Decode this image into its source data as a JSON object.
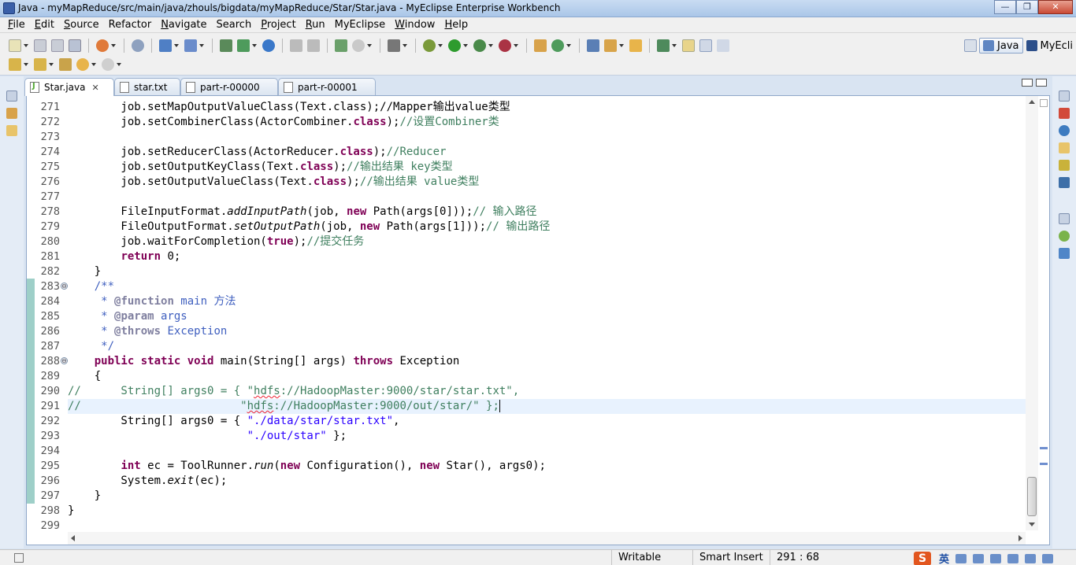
{
  "window": {
    "title": "Java - myMapReduce/src/main/java/zhouls/bigdata/myMapReduce/Star/Star.java - MyEclipse Enterprise Workbench",
    "minimize": "—",
    "maximize": "❐",
    "close": "✕"
  },
  "menu": [
    {
      "label": "File",
      "u": "F",
      "rest": "ile"
    },
    {
      "label": "Edit",
      "u": "E",
      "rest": "dit"
    },
    {
      "label": "Source",
      "u": "S",
      "rest": "ource"
    },
    {
      "label": "Refactor",
      "u": "",
      "rest": "Refactor"
    },
    {
      "label": "Navigate",
      "u": "N",
      "rest": "avigate"
    },
    {
      "label": "Search",
      "u": "",
      "rest": "Search"
    },
    {
      "label": "Project",
      "u": "P",
      "rest": "roject"
    },
    {
      "label": "Run",
      "u": "R",
      "rest": "un"
    },
    {
      "label": "MyEclipse",
      "u": "",
      "rest": "MyEclipse"
    },
    {
      "label": "Window",
      "u": "W",
      "rest": "indow"
    },
    {
      "label": "Help",
      "u": "H",
      "rest": "elp"
    }
  ],
  "perspectives": {
    "java": "Java",
    "myeclipse": "MyEcli"
  },
  "tabs": [
    {
      "label": "Star.java",
      "close": "✕",
      "active": true
    },
    {
      "label": "star.txt",
      "close": "",
      "active": false
    },
    {
      "label": "part-r-00000",
      "close": "",
      "active": false
    },
    {
      "label": "part-r-00001",
      "close": "",
      "active": false
    }
  ],
  "editor": {
    "lines": [
      {
        "n": "271",
        "fold": "",
        "html": "        job.setMapOutputValueClass(Text.class);//Mapper输出value类型"
      },
      {
        "n": "272",
        "fold": "",
        "html": "        job.setCombinerClass(ActorCombiner.<span class=\"kw\">class</span>);<span class=\"cm\">//设置Combiner类</span>"
      },
      {
        "n": "273",
        "fold": "",
        "html": ""
      },
      {
        "n": "274",
        "fold": "",
        "html": "        job.setReducerClass(ActorReducer.<span class=\"kw\">class</span>);<span class=\"cm\">//Reducer</span>"
      },
      {
        "n": "275",
        "fold": "",
        "html": "        job.setOutputKeyClass(Text.<span class=\"kw\">class</span>);<span class=\"cm\">//输出结果 key类型</span>"
      },
      {
        "n": "276",
        "fold": "",
        "html": "        job.setOutputValueClass(Text.<span class=\"kw\">class</span>);<span class=\"cm\">//输出结果 value类型</span>"
      },
      {
        "n": "277",
        "fold": "",
        "html": ""
      },
      {
        "n": "278",
        "fold": "",
        "html": "        FileInputFormat.<span class=\"it\">addInputPath</span>(job, <span class=\"kw\">new</span> Path(args[0]));<span class=\"cm\">// 输入路径</span>"
      },
      {
        "n": "279",
        "fold": "",
        "html": "        FileOutputFormat.<span class=\"it\">setOutputPath</span>(job, <span class=\"kw\">new</span> Path(args[1]));<span class=\"cm\">// 输出路径</span>"
      },
      {
        "n": "280",
        "fold": "",
        "html": "        job.waitForCompletion(<span class=\"kw\">true</span>);<span class=\"cm\">//提交任务</span>"
      },
      {
        "n": "281",
        "fold": "",
        "html": "        <span class=\"kw\">return</span> 0;"
      },
      {
        "n": "282",
        "fold": "",
        "html": "    }"
      },
      {
        "n": "283",
        "fold": "⊖",
        "html": "    <span class=\"jd\">/**</span>"
      },
      {
        "n": "284",
        "fold": "",
        "html": "<span class=\"jd\">     * </span><span class=\"jt\">@function</span><span class=\"jd\"> main 方法</span>"
      },
      {
        "n": "285",
        "fold": "",
        "html": "<span class=\"jd\">     * </span><span class=\"jt\">@param</span><span class=\"jd\"> args</span>"
      },
      {
        "n": "286",
        "fold": "",
        "html": "<span class=\"jd\">     * </span><span class=\"jt\">@throws</span><span class=\"jd\"> Exception</span>"
      },
      {
        "n": "287",
        "fold": "",
        "html": "<span class=\"jd\">     */</span>"
      },
      {
        "n": "288",
        "fold": "⊖",
        "html": "    <span class=\"kw\">public static void</span> main(String[] args) <span class=\"kw\">throws</span> Exception"
      },
      {
        "n": "289",
        "fold": "",
        "html": "    {"
      },
      {
        "n": "290",
        "fold": "",
        "html": "<span class=\"cm\">//      String[] args0 = { \"<span class=\"squig\">hdfs</span>://HadoopMaster:9000/star/star.txt\",</span>"
      },
      {
        "n": "291",
        "fold": "",
        "current": true,
        "html": "<span class=\"cm\">//                        \"<span class=\"squig\">hdfs</span>://HadoopMaster:9000/out/star/\" };</span><span class=\"cur\"></span>"
      },
      {
        "n": "292",
        "fold": "",
        "html": "        String[] args0 = { <span class=\"st\">\"./data/star/star.txt\"</span>,"
      },
      {
        "n": "293",
        "fold": "",
        "html": "                           <span class=\"st\">\"./out/star\"</span> };"
      },
      {
        "n": "294",
        "fold": "",
        "html": ""
      },
      {
        "n": "295",
        "fold": "",
        "html": "        <span class=\"kw\">int</span> ec = ToolRunner.<span class=\"it\">run</span>(<span class=\"kw\">new</span> Configuration(), <span class=\"kw\">new</span> Star(), args0);"
      },
      {
        "n": "296",
        "fold": "",
        "html": "        System.<span class=\"it\">exit</span>(ec);"
      },
      {
        "n": "297",
        "fold": "",
        "html": "    }"
      },
      {
        "n": "298",
        "fold": "",
        "html": "}"
      },
      {
        "n": "299",
        "fold": "",
        "html": ""
      }
    ]
  },
  "status": {
    "writable": "Writable",
    "insert_mode": "Smart Insert",
    "position": "291 : 68",
    "ime_logo": "S",
    "ime_lang": "英"
  },
  "colors": {
    "keyword": "#7f0055",
    "comment": "#3f7f5f",
    "javadoc": "#3f5fbf",
    "string": "#2a00ff",
    "current_line": "#e8f2fe"
  }
}
